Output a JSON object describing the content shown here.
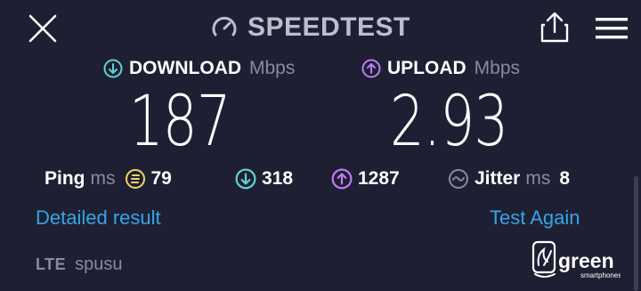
{
  "header": {
    "title": "SPEEDTEST",
    "close_icon": "close-icon",
    "gauge_icon": "speedometer-icon",
    "share_icon": "share-icon",
    "menu_icon": "hamburger-menu-icon"
  },
  "download": {
    "label": "DOWNLOAD",
    "unit": "Mbps",
    "value": "187",
    "icon": "download-arrow-icon",
    "color": "#5fd3d0"
  },
  "upload": {
    "label": "UPLOAD",
    "unit": "Mbps",
    "value": "2.93",
    "icon": "upload-arrow-icon",
    "color": "#c07cf2"
  },
  "stats": {
    "ping_label": "Ping",
    "ping_unit": "ms",
    "ping_value": "79",
    "ping_icon": "idle-latency-icon",
    "download_latency": "318",
    "upload_latency": "1287",
    "jitter_label": "Jitter",
    "jitter_unit": "ms",
    "jitter_value": "8",
    "jitter_icon": "jitter-icon"
  },
  "links": {
    "detailed": "Detailed result",
    "again": "Test Again"
  },
  "footer": {
    "network": "LTE",
    "carrier": "spusu",
    "logo_text": "green",
    "logo_sub": "smartphones"
  },
  "colors": {
    "background": "#1f1f33",
    "link": "#33a6e6",
    "ping_accent": "#f0d66a",
    "muted": "#8a8a9c"
  }
}
